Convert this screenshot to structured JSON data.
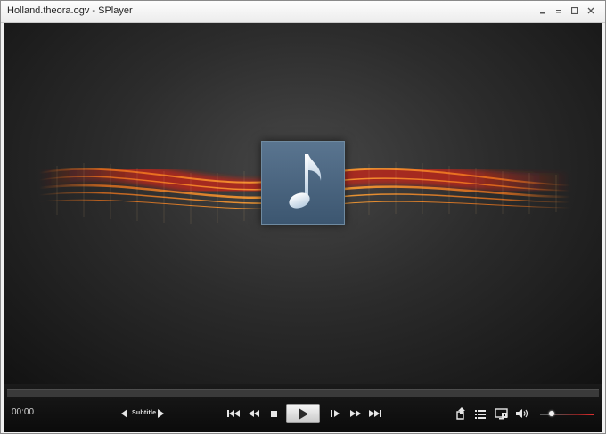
{
  "window": {
    "title": "Holland.theora.ogv - SPlayer",
    "minimize_glyph": "–",
    "maximize_glyph": "□",
    "close_glyph": "✕"
  },
  "artwork": {
    "icon": "music-note-icon"
  },
  "playback": {
    "time": "00:00",
    "progress": 0,
    "volume": 0.22
  },
  "subtitle": {
    "label": "Subtitle"
  },
  "icons": {
    "subtitle_prev": "triangle-left-icon",
    "subtitle_next": "triangle-right-icon",
    "skip_prev": "skip-previous-icon",
    "rewind": "rewind-icon",
    "stop": "stop-icon",
    "play": "play-icon",
    "frame_step": "frame-step-icon",
    "fast_forward": "fast-forward-icon",
    "skip_next": "skip-next-icon",
    "open": "open-file-icon",
    "playlist": "playlist-icon",
    "settings": "screen-settings-icon",
    "volume": "speaker-icon"
  },
  "colors": {
    "wave_hot": "#ff7a1a",
    "wave_red": "#c02818",
    "art_bg": "#4a6680",
    "volume_red": "#e03030"
  }
}
